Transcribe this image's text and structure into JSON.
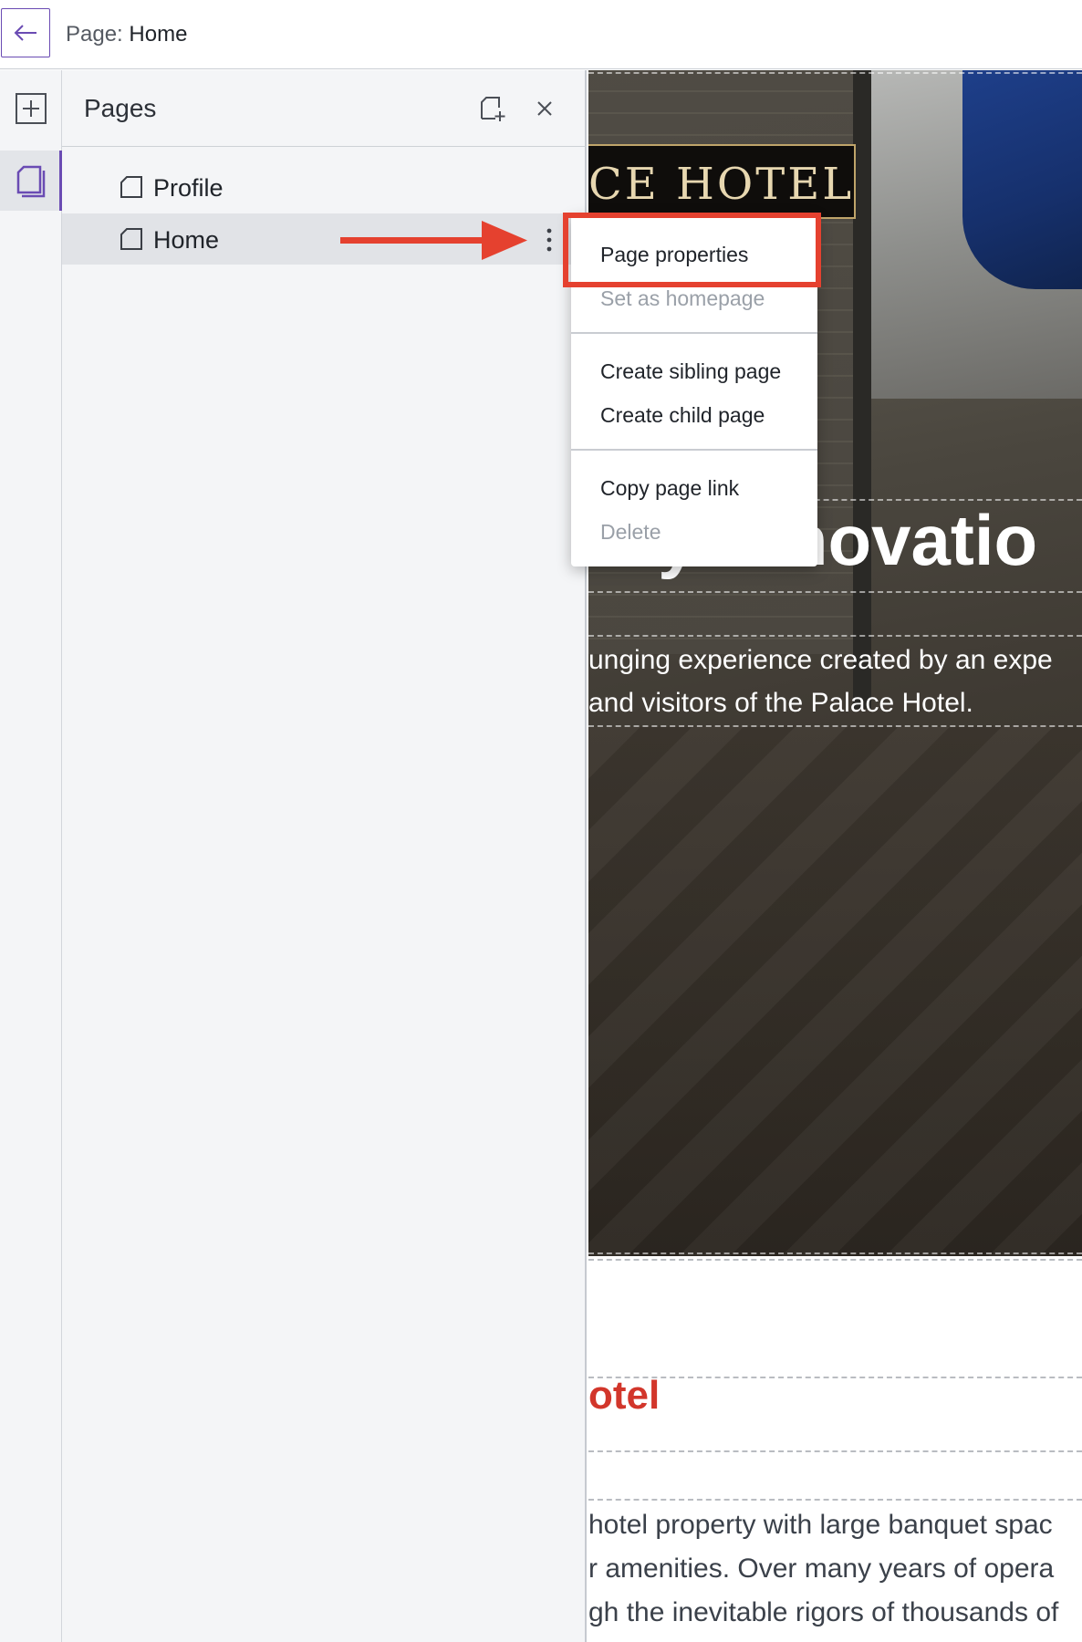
{
  "topbar": {
    "page_prefix": "Page:",
    "page_name": "Home"
  },
  "panel": {
    "title": "Pages",
    "items": [
      {
        "label": "Profile"
      },
      {
        "label": "Home",
        "selected": true
      }
    ]
  },
  "context_menu": {
    "items": [
      {
        "label": "Page properties",
        "enabled": true,
        "highlighted": true
      },
      {
        "label": "Set as homepage",
        "enabled": false
      },
      {
        "label": "Create sibling page",
        "enabled": true
      },
      {
        "label": "Create child page",
        "enabled": true
      },
      {
        "label": "Copy page link",
        "enabled": true
      },
      {
        "label": "Delete",
        "enabled": false
      }
    ]
  },
  "canvas": {
    "logo_text": "CE HOTEL",
    "hero_heading": "visby renovatio",
    "hero_line_1": "unging experience created by an expe",
    "hero_line_2": "and visitors of the Palace Hotel.",
    "section_title": "otel",
    "body_line_1": "hotel property with large banquet spac",
    "body_line_2": "r amenities. Over many years of opera",
    "body_line_3": "gh the inevitable rigors of thousands of"
  },
  "colors": {
    "accent": "#6a4bb3",
    "annotation_red": "#e5412f",
    "section_title_red": "#d2362b"
  },
  "icons": {
    "back": "arrow-left-icon",
    "rail_add": "plus-square-icon",
    "rail_pages": "pages-icon",
    "panel_add": "add-page-icon",
    "panel_close": "close-icon",
    "page": "document-icon",
    "more": "kebab-menu-icon"
  }
}
